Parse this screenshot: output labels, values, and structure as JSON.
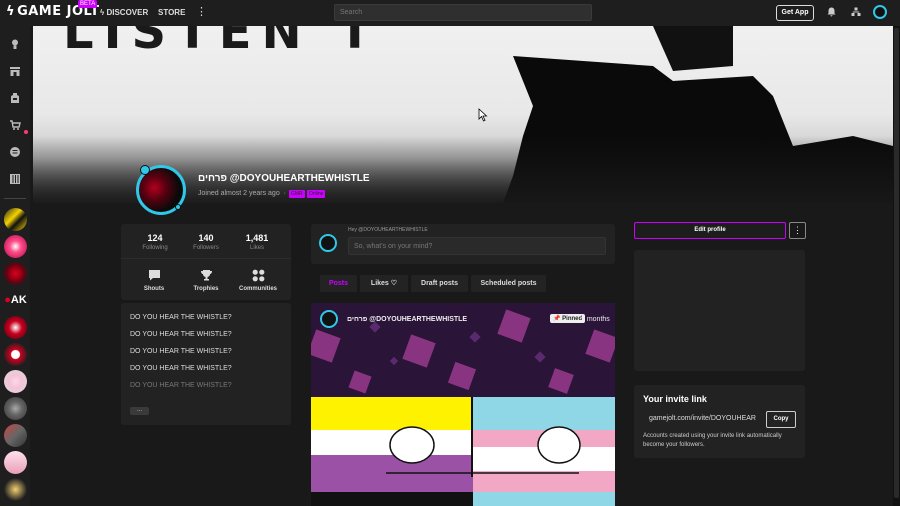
{
  "header": {
    "logo": "GAME JOLT",
    "logo_badge": "BETA",
    "nav_discover": "DISCOVER",
    "nav_store": "STORE",
    "search_placeholder": "Search",
    "get_app": "Get App"
  },
  "profile": {
    "display_name": "פרחים",
    "username": "@DOYOUHEARTHEWHISTLE",
    "joined": "Joined almost 2 years ago",
    "tags": [
      "GMR",
      "Online"
    ]
  },
  "stats": [
    {
      "value": "124",
      "label": "Following"
    },
    {
      "value": "140",
      "label": "Followers"
    },
    {
      "value": "1,481",
      "label": "Likes"
    }
  ],
  "quick_links": [
    {
      "label": "Shouts",
      "icon": "speech-bubble-icon"
    },
    {
      "label": "Trophies",
      "icon": "trophy-icon"
    },
    {
      "label": "Communities",
      "icon": "communities-icon"
    }
  ],
  "shouts": [
    "DO YOU HEAR THE WHISTLE?",
    "DO YOU HEAR THE WHISTLE?",
    "DO YOU HEAR THE WHISTLE?",
    "DO YOU HEAR THE WHISTLE?",
    "DO YOU HEAR THE WHISTLE?"
  ],
  "shouts_more": "...",
  "composer": {
    "greeting": "Hey @DOYOUHEARTHEWHISTLE",
    "placeholder": "So, what's on your mind?"
  },
  "tabs": [
    {
      "label": "Posts",
      "active": true
    },
    {
      "label": "Likes",
      "active": false
    },
    {
      "label": "Draft posts",
      "active": false
    },
    {
      "label": "Scheduled posts",
      "active": false
    }
  ],
  "post": {
    "author": "פרחים @DOYOUHEARTHEWHISTLE",
    "pinned": "Pinned",
    "time": "9 months"
  },
  "right": {
    "edit_profile": "Edit profile",
    "invite_title": "Your invite link",
    "invite_link": "gamejolt.com/invite/DOYOUHEAR",
    "copy": "Copy",
    "invite_desc": "Accounts created using your invite link automatically become your followers."
  },
  "colors": {
    "accent": "#cc00ff",
    "cyan": "#2fc8e8",
    "background": "#191919",
    "card": "#222222"
  }
}
